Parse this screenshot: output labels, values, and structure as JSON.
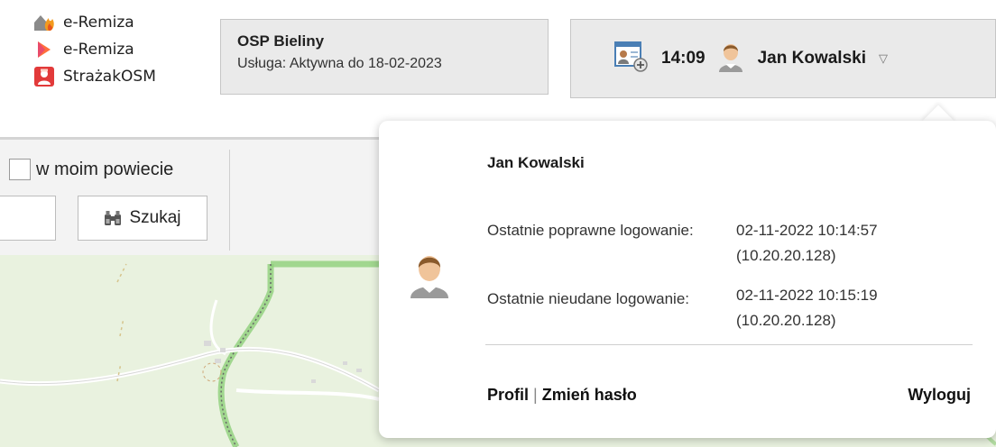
{
  "apps": [
    {
      "label": "e-Remiza",
      "icon": "e-remiza-logo-icon"
    },
    {
      "label": "e-Remiza",
      "icon": "play-store-icon"
    },
    {
      "label": "StrażakOSM",
      "icon": "strazak-osm-icon"
    }
  ],
  "unit": {
    "name": "OSP Bieliny",
    "status": "Usługa: Aktywna do 18-02-2023"
  },
  "user_bar": {
    "time": "14:09",
    "user_name": "Jan Kowalski",
    "caret": "▽"
  },
  "search": {
    "checkbox_label": "w moim powiecie",
    "button_label": "Szukaj"
  },
  "dropdown": {
    "user_name": "Jan Kowalski",
    "last_success_label": "Ostatnie poprawne logowanie:",
    "last_success_datetime": "02-11-2022 10:14:57",
    "last_success_ip": "(10.20.20.128)",
    "last_fail_label": "Ostatnie nieudane logowanie:",
    "last_fail_datetime": "02-11-2022 10:15:19",
    "last_fail_ip": "(10.20.20.128)",
    "profile_link": "Profil",
    "separator": "|",
    "change_password_link": "Zmień hasło",
    "logout_link": "Wyloguj"
  },
  "colors": {
    "header_box_bg": "#eaeaea",
    "map_bg": "#e9f2df",
    "map_boundary": "#8fcf7a"
  }
}
